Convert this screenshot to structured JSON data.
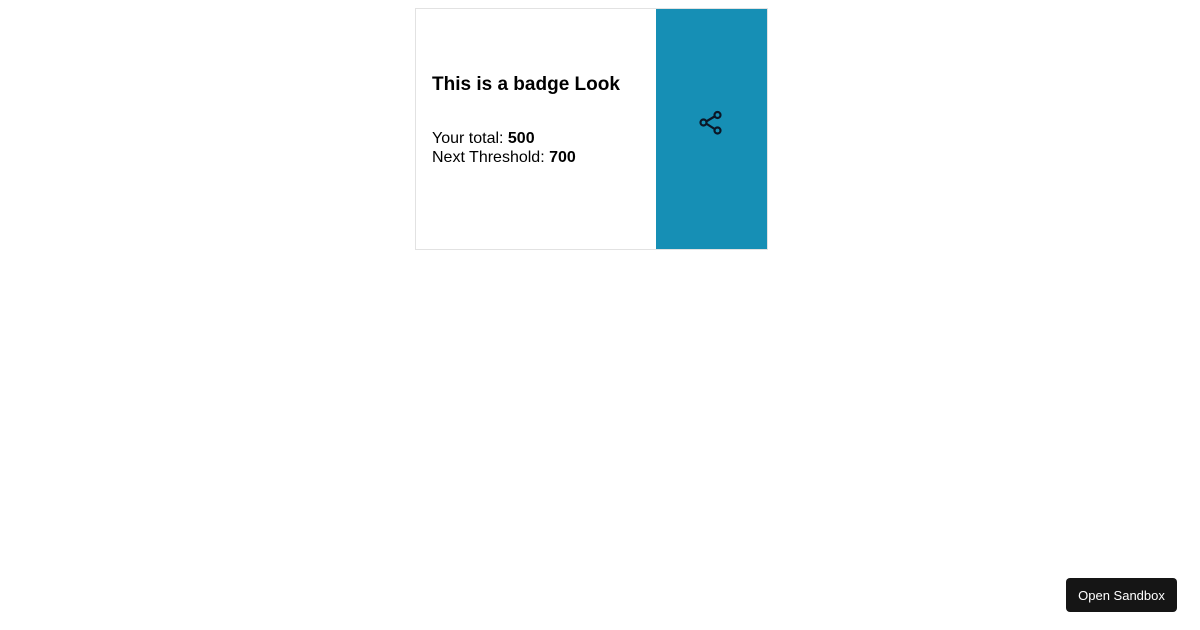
{
  "badge": {
    "title": "This is a badge Look",
    "total_label": "Your total: ",
    "total_value": "500",
    "threshold_label": "Next Threshold: ",
    "threshold_value": "700",
    "accent_color": "#168fb5",
    "share_icon": "share-icon"
  },
  "sandbox_button": {
    "label": "Open Sandbox"
  }
}
